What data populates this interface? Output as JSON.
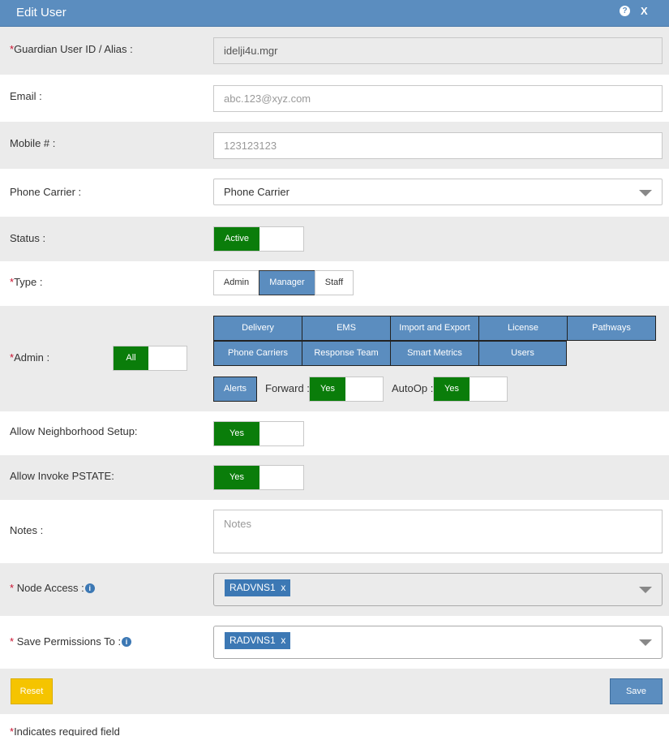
{
  "dialog": {
    "title": "Edit User",
    "help_glyph": "?",
    "close_label": "X"
  },
  "fields": {
    "user_id": {
      "label": "Guardian User ID / Alias :",
      "value": "idelji4u.mgr"
    },
    "email": {
      "label": "Email :",
      "value": "abc.123@xyz.com"
    },
    "mobile": {
      "label": "Mobile # :",
      "value": "123123123"
    },
    "carrier": {
      "label": "Phone Carrier :",
      "value": "Phone Carrier"
    },
    "status": {
      "label": "Status :",
      "toggle": "Active"
    },
    "type": {
      "label": "Type :",
      "options": [
        "Admin",
        "Manager",
        "Staff"
      ],
      "selected": "Manager"
    },
    "admin": {
      "label": "Admin :",
      "all_toggle": "All",
      "permissions": [
        "Delivery",
        "EMS",
        "Import and Export",
        "License",
        "Pathways",
        "Phone Carriers",
        "Response Team",
        "Smart Metrics",
        "Users"
      ],
      "alerts": "Alerts",
      "forward_label": "Forward :",
      "forward_toggle": "Yes",
      "autoop_label": "AutoOp :",
      "autoop_toggle": "Yes"
    },
    "neighborhood": {
      "label": "Allow Neighborhood Setup:",
      "toggle": "Yes"
    },
    "pstate": {
      "label": "Allow Invoke PSTATE:",
      "toggle": "Yes"
    },
    "notes": {
      "label": "Notes :",
      "placeholder": "Notes"
    },
    "node_access": {
      "label": "Node Access :",
      "tag": "RADVNS1",
      "tag_remove": "x"
    },
    "save_permissions": {
      "label": "Save Permissions To :",
      "tag": "RADVNS1",
      "tag_remove": "x"
    }
  },
  "actions": {
    "reset": "Reset",
    "save": "Save"
  },
  "footer": {
    "required_note": "Indicates required field"
  },
  "icons": {
    "help": "question-circle-icon",
    "info": "info-circle-icon",
    "dropdown": "caret-down-icon"
  },
  "colors": {
    "header": "#5b8dbf",
    "toggle_on": "#0a7d0a",
    "required": "#c8102e",
    "reset": "#f5c400",
    "save": "#5b8dbf"
  }
}
